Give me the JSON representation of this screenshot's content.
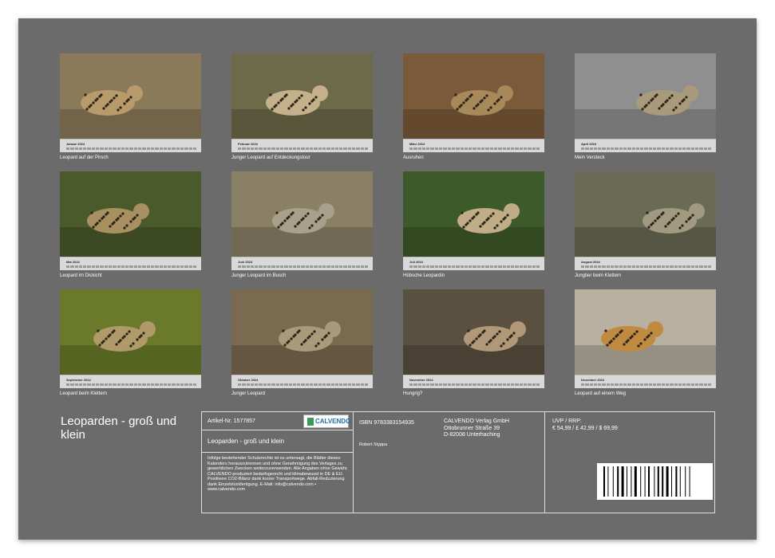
{
  "months": [
    {
      "month": "Januar 2024",
      "caption": "Leopard auf der Pirsch",
      "bg": "#8a7a5a",
      "fg": "#b99a6a"
    },
    {
      "month": "Februar 2024",
      "caption": "Junger Leopard auf Entdeckungstour",
      "bg": "#6d6a4a",
      "fg": "#c4b08a"
    },
    {
      "month": "März 2024",
      "caption": "Ausruhen",
      "bg": "#7a5a3a",
      "fg": "#a88a5a"
    },
    {
      "month": "April 2024",
      "caption": "Mein Versteck",
      "bg": "#8f8f8f",
      "fg": "#a89a7a"
    },
    {
      "month": "Mai 2024",
      "caption": "Leopard im Dickicht",
      "bg": "#4a5a2a",
      "fg": "#a89060"
    },
    {
      "month": "Juni 2024",
      "caption": "Junger Leopard im Busch",
      "bg": "#8a8066",
      "fg": "#a8a08a"
    },
    {
      "month": "Juli 2024",
      "caption": "Hübsche Leopardin",
      "bg": "#3d5a2a",
      "fg": "#c0ad88"
    },
    {
      "month": "August 2024",
      "caption": "Jungtier beim Klettern",
      "bg": "#6a6a55",
      "fg": "#a09a80"
    },
    {
      "month": "September 2024",
      "caption": "Leopard beim Klettern",
      "bg": "#6a7a2a",
      "fg": "#b09a6a"
    },
    {
      "month": "Oktober 2024",
      "caption": "Junger Leopard",
      "bg": "#7a6a50",
      "fg": "#a89a7a"
    },
    {
      "month": "November 2024",
      "caption": "Hungrig?",
      "bg": "#5a5040",
      "fg": "#b09878"
    },
    {
      "month": "Dezember 2024",
      "caption": "Leopard auf einem Weg",
      "bg": "#b8b0a0",
      "fg": "#c08a40"
    }
  ],
  "info": {
    "title": "Leoparden - groß und klein",
    "article": "Artikel-Nr. 1577857",
    "logo": "CALVENDO",
    "subtitle": "Leoparden - groß und klein",
    "legal": "Infolge bestehender Schutzrechte ist es untersagt, die Blätter dieses Kalenders herauszutrennen und ohne Genehmigung des Verlages zu gewerblichen Zwecken weiterzuverwenden. Alle Angaben ohne Gewähr. CALVENDO produziert bedarfsgerecht und klimabewusst in DE & EU. Positivere CO2-Bilanz dank kurzer Transportwege. Abfall-Reduzierung dank Einzelstückfertigung. E-Mail: info@calvendo.com • www.calvendo.com",
    "isbn": "ISBN 9783383154935",
    "author": "Robert Styppa",
    "publisher_line1": "CALVENDO Verlag GmbH",
    "publisher_line2": "Ottobrunner Straße 39",
    "publisher_line3": "D-82008 Unterhaching",
    "price_label": "UVP / RRP:",
    "price": "€ 54,99 / £ 42,99 / $ 69,99"
  }
}
